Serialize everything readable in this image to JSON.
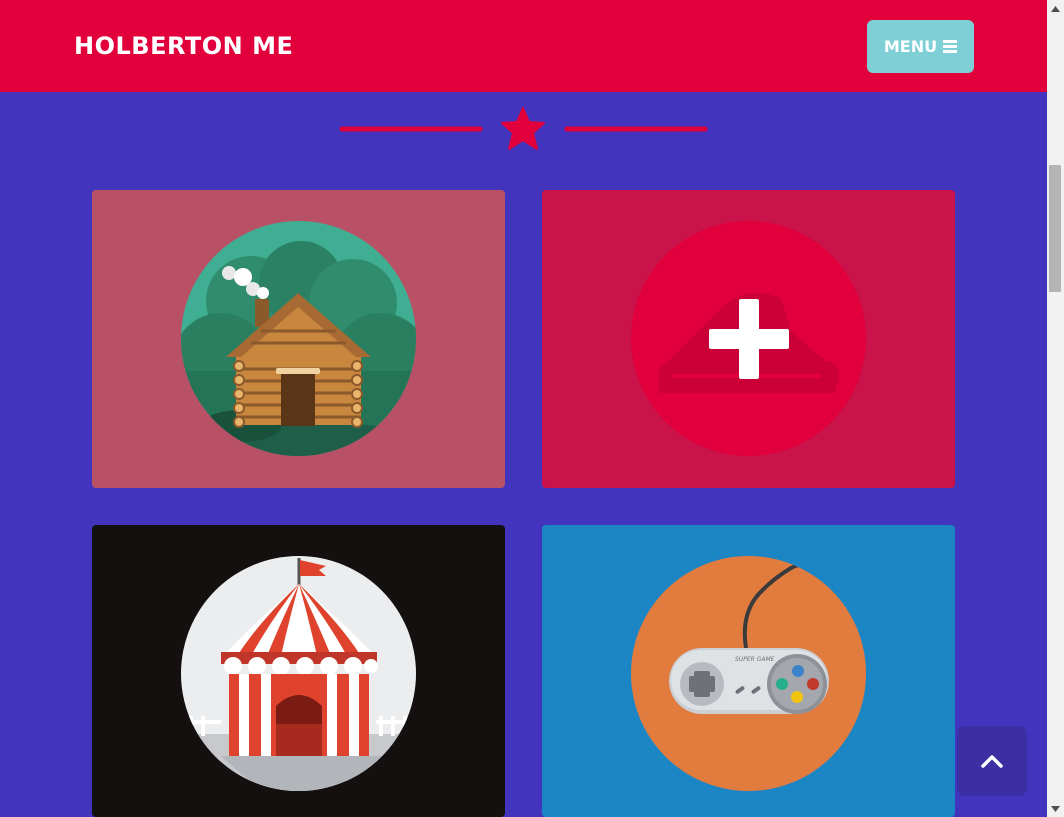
{
  "navbar": {
    "brand": "HOLBERTON ME",
    "menu_label": "MENU",
    "menu_icon": "bars-icon"
  },
  "divider": {
    "icon": "star-icon"
  },
  "portfolio": {
    "items": [
      {
        "icon": "log-cabin-icon",
        "background": "#b95166",
        "disc": "#3fae93"
      },
      {
        "icon": "plus-icon",
        "background": "#c9134a",
        "disc": "#e1003c"
      },
      {
        "icon": "circus-tent-icon",
        "background": "#141010",
        "disc": "#ecedee"
      },
      {
        "icon": "game-controller-icon",
        "background": "#1c86c5",
        "disc": "#e27b3e"
      }
    ]
  },
  "scroll_to_top": {
    "icon": "chevron-up-icon"
  },
  "colors": {
    "page_bg": "#4334be",
    "navbar_bg": "#e1003c",
    "menu_button_bg": "#7ed0d6",
    "accent": "#e1003c"
  }
}
